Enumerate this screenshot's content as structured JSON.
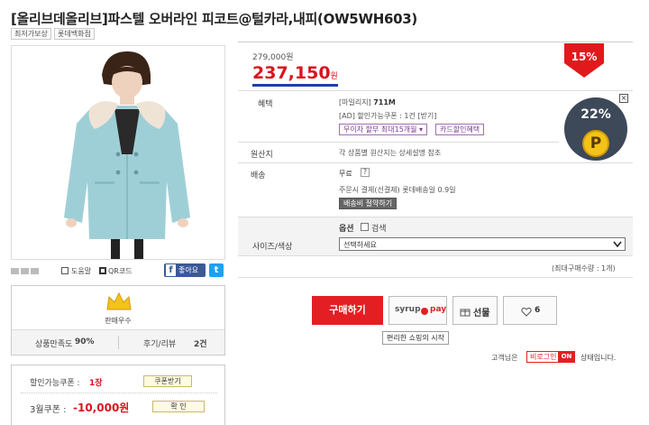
{
  "product": {
    "title": "[올리브데올리브]파스텔 오버라인 피코트@털카라,내피(OW5WH603)",
    "tags": [
      "최저가보상",
      "롯데백화점"
    ]
  },
  "image_tools": {
    "zoom_label": "도움말",
    "qr_label": "QR코드",
    "facebook_like": "좋아요",
    "facebook_f": "f",
    "twitter": "t"
  },
  "seller": {
    "badge_label": "판매우수",
    "satisfaction_label": "상품만족도",
    "satisfaction_value": "90%",
    "review_label": "후기/리뷰",
    "review_value": "2건"
  },
  "coupons": {
    "available_label": "할인가능쿠폰 :",
    "available_count": "1장",
    "receive_button": "쿠폰받기",
    "third_month_label": "3월쿠폰 :",
    "third_month_value": "-10,000원",
    "confirm_button": "확 인"
  },
  "price": {
    "original": "279,000원",
    "sale": "237,150",
    "sale_unit": "원",
    "discount_rate": "15%"
  },
  "benefits": {
    "label": "혜택",
    "mileage_label": "[마일리지]",
    "mileage_value": "711M",
    "ad_coupon": "[AD] 할인가능쿠폰 : 1건 [받기]",
    "installment_button": "무이자 할부 최대15개월 ▾",
    "card_discount_button": "카드할인혜택"
  },
  "promo_badge": {
    "rate": "22%",
    "symbol": "P",
    "close": "×"
  },
  "origin": {
    "label": "원산지",
    "value": "각 상품별 원산지는 상세설명 참조"
  },
  "shipping": {
    "label": "배송",
    "fee": "무료",
    "help": "?",
    "note": "주문시 결제(선결제) 롯데배송일 0.9일",
    "calc_button": "배송비 절약하기"
  },
  "options": {
    "section_label": "옵션",
    "search_label": "검색",
    "size_label": "사이즈/색상",
    "select_value": "선택하세요",
    "max_qty": "(최대구매수량 : 1개)"
  },
  "actions": {
    "buy": "구매하기",
    "syrup": "syrup",
    "pay": "pay",
    "gift": "선물",
    "like_count": "6",
    "syrup_tooltip": "편리한 쇼핑의 시작"
  },
  "customer_status": {
    "prefix": "고객님은",
    "state": "비로그인",
    "toggle": "ON",
    "suffix": "상태입니다."
  },
  "colors": {
    "sale_price": "#d9141f",
    "buy_button": "#e31f23",
    "discount_flag": "#e2191c",
    "coat": "#9fcfd6",
    "promo_dark": "#3d4858",
    "coin": "#f3c318"
  }
}
